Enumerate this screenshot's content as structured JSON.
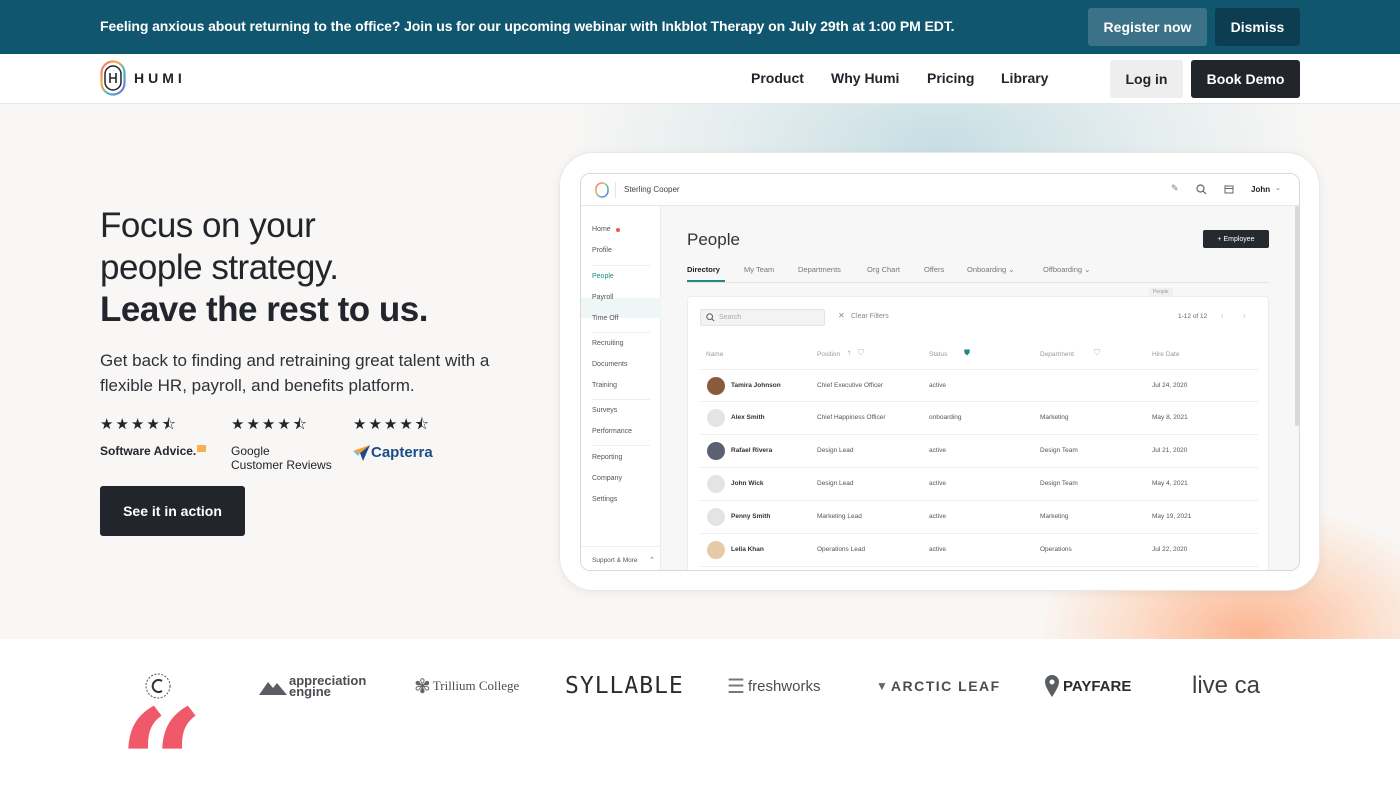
{
  "announcement": {
    "text": "Feeling anxious about returning to the office? Join us for our upcoming webinar with Inkblot Therapy on July 29th at 1:00 PM EDT.",
    "register_label": "Register now",
    "dismiss_label": "Dismiss"
  },
  "header": {
    "logo_text": "HUMI",
    "nav": [
      {
        "label": "Product"
      },
      {
        "label": "Why Humi"
      },
      {
        "label": "Pricing"
      },
      {
        "label": "Library"
      }
    ],
    "login_label": "Log in",
    "demo_label": "Book Demo"
  },
  "hero": {
    "headline_1": "Focus on your",
    "headline_2": "people strategy.",
    "headline_3": "Leave the rest to us.",
    "subtext": "Get back to finding and retraining great talent with a flexible HR, payroll, and benefits platform.",
    "cta_label": "See it in action",
    "ratings": [
      {
        "stars": 4.5,
        "stars_text": "★★★★⯪",
        "label": "Software Advice."
      },
      {
        "stars": 4.5,
        "stars_text": "★★★★⯪",
        "label_1": "Google",
        "label_2": "Customer Reviews"
      },
      {
        "stars": 4.5,
        "stars_text": "★★★★⯪",
        "label": "Capterra"
      }
    ]
  },
  "app_mock": {
    "company": "Sterling Cooper",
    "user": "John",
    "sidebar": [
      {
        "label": "Home"
      },
      {
        "label": "Profile"
      },
      {
        "label": "People"
      },
      {
        "label": "Payroll"
      },
      {
        "label": "Time Off"
      },
      {
        "label": "Recruiting"
      },
      {
        "label": "Documents"
      },
      {
        "label": "Training"
      },
      {
        "label": "Surveys"
      },
      {
        "label": "Performance"
      },
      {
        "label": "Reporting"
      },
      {
        "label": "Company"
      },
      {
        "label": "Settings"
      }
    ],
    "sidebar_footer": "Support & More",
    "page_title": "People",
    "add_button": "+ Employee",
    "tabs": [
      {
        "label": "Directory"
      },
      {
        "label": "My Team"
      },
      {
        "label": "Departments"
      },
      {
        "label": "Org Chart"
      },
      {
        "label": "Offers"
      },
      {
        "label": "Onboarding ⌄"
      },
      {
        "label": "Offboarding ⌄"
      }
    ],
    "tooltip": "People",
    "search_placeholder": "Search",
    "clear_filters": "Clear Filters",
    "pager": "1-12 of 12",
    "columns": [
      "Name",
      "Position",
      "Status",
      "Department",
      "Hire Date"
    ],
    "rows": [
      {
        "name": "Tamira Johnson",
        "position": "Chief Executive Officer",
        "status": "active",
        "department": "",
        "hire_date": "Jul 24, 2020"
      },
      {
        "name": "Alex Smith",
        "position": "Chief Happiness Officer",
        "status": "onboarding",
        "department": "Marketing",
        "hire_date": "May 8, 2021"
      },
      {
        "name": "Rafael Rivera",
        "position": "Design Lead",
        "status": "active",
        "department": "Design Team",
        "hire_date": "Jul 21, 2020"
      },
      {
        "name": "John Wick",
        "position": "Design Lead",
        "status": "active",
        "department": "Design Team",
        "hire_date": "May 4, 2021"
      },
      {
        "name": "Penny Smith",
        "position": "Marketing Lead",
        "status": "active",
        "department": "Marketing",
        "hire_date": "May 19, 2021"
      },
      {
        "name": "Leila Khan",
        "position": "Operations Lead",
        "status": "active",
        "department": "Operations",
        "hire_date": "Jul 22, 2020"
      }
    ]
  },
  "logos": [
    {
      "name": "appreciation engine",
      "line_1": "appreciation",
      "line_2": "engine"
    },
    {
      "name": "Trillium College"
    },
    {
      "name": "SYLLABLE"
    },
    {
      "name": "freshworks"
    },
    {
      "name": "ARCTIC LEAF"
    },
    {
      "name": "PAYFARE"
    },
    {
      "name": "live ca"
    }
  ],
  "quote_mark": "“",
  "colors": {
    "announce_bg": "#11566f",
    "dark": "#22252b",
    "teal_accent": "#1f8a8a",
    "quote_pink": "#f0596a"
  }
}
